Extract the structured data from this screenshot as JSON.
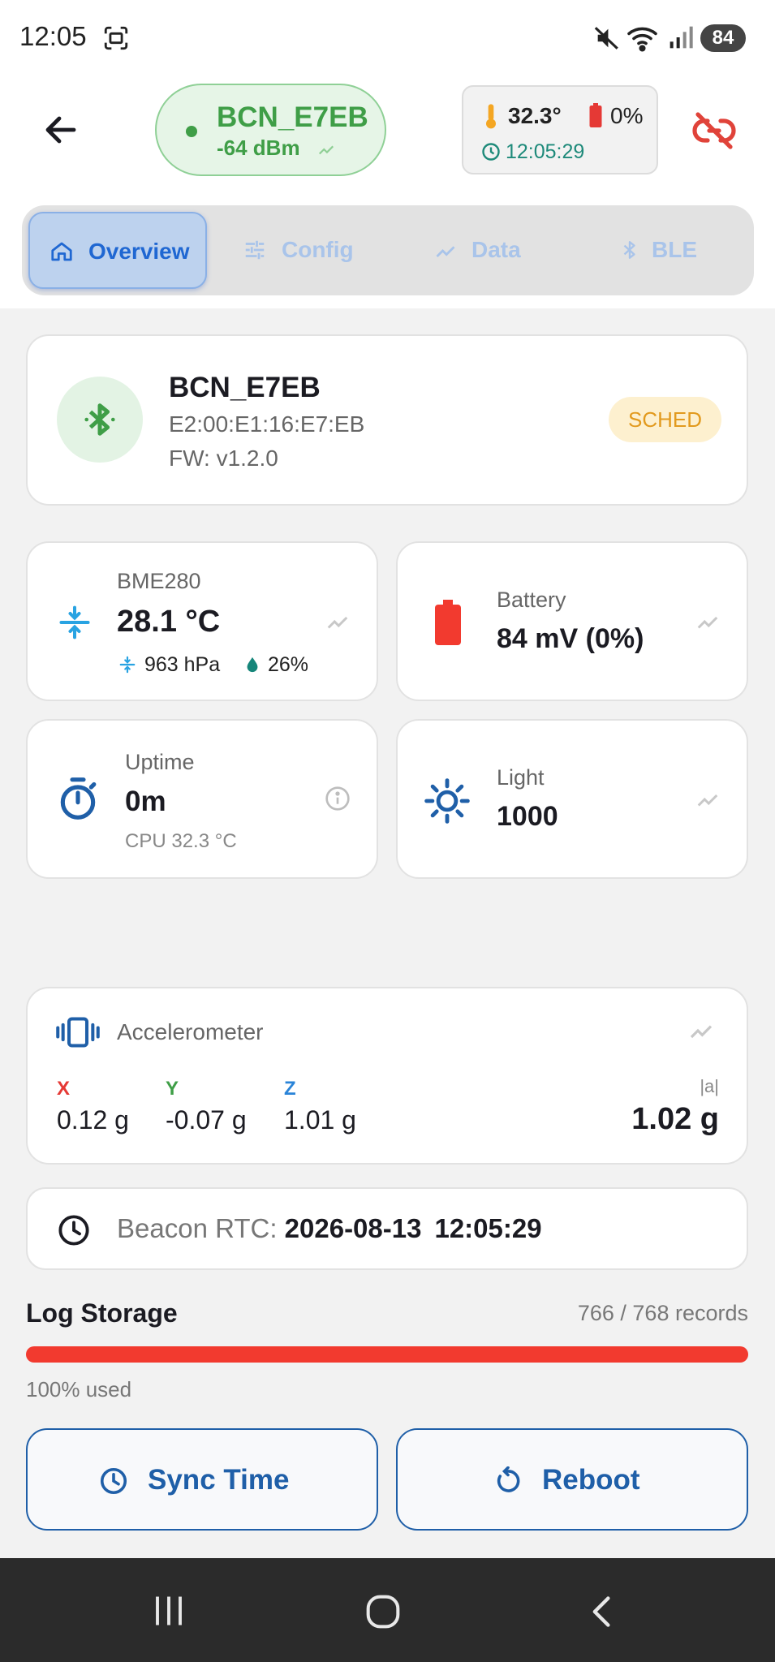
{
  "status_bar": {
    "time": "12:05",
    "battery": "84"
  },
  "header": {
    "device_name": "BCN_E7EB",
    "rssi": "-64 dBm",
    "temperature": "32.3°",
    "battery_pct": "0%",
    "clock": "12:05:29"
  },
  "tabs": [
    {
      "label": "Overview",
      "active": true
    },
    {
      "label": "Config"
    },
    {
      "label": "Data"
    },
    {
      "label": "BLE"
    }
  ],
  "device_card": {
    "name": "BCN_E7EB",
    "mac": "E2:00:E1:16:E7:EB",
    "firmware": "FW: v1.2.0",
    "badge": "SCHED"
  },
  "bme280": {
    "label": "BME280",
    "temp": "28.1 °C",
    "pressure": "963 hPa",
    "humidity": "26%"
  },
  "battery": {
    "label": "Battery",
    "value": "84 mV (0%)"
  },
  "uptime": {
    "label": "Uptime",
    "value": "0m",
    "cpu": "CPU 32.3 °C"
  },
  "light": {
    "label": "Light",
    "value": "1000"
  },
  "accelerometer": {
    "label": "Accelerometer",
    "x_label": "X",
    "x": "0.12 g",
    "y_label": "Y",
    "y": "-0.07 g",
    "z_label": "Z",
    "z": "1.01 g",
    "mag_label": "|a|",
    "mag": "1.02 g"
  },
  "rtc": {
    "label": "Beacon RTC: ",
    "date": "2026-08-13",
    "time": "12:05:29"
  },
  "log_storage": {
    "title": "Log Storage",
    "records": "766 / 768 records",
    "used": "100% used",
    "used_fraction": 1.0
  },
  "actions": {
    "sync_label": "Sync Time",
    "reboot_label": "Reboot"
  },
  "colors": {
    "accent": "#1f5fa8",
    "green": "#3f9e47",
    "red": "#f23a2f",
    "orange": "#e29a1e"
  }
}
